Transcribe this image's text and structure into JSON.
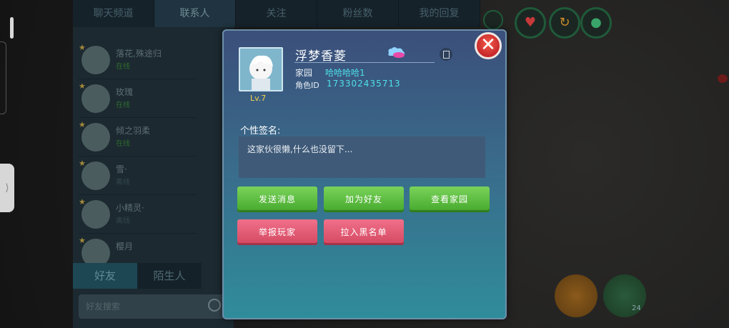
{
  "top_tabs": [
    "聊天频道",
    "联系人",
    "关注",
    "粉丝数",
    "我的回复"
  ],
  "friends": [
    {
      "name": "落花,殊途归",
      "status": "在线",
      "online": true
    },
    {
      "name": "玫瑰",
      "status": "在线",
      "online": true
    },
    {
      "name": "倾之羽柔",
      "status": "在线",
      "online": true
    },
    {
      "name": "雪·",
      "status": "离线",
      "online": false
    },
    {
      "name": "小精灵·",
      "status": "离线",
      "online": false
    },
    {
      "name": "樱月",
      "status": "",
      "online": false
    }
  ],
  "bottom_tabs": {
    "friends": "好友",
    "strangers": "陌生人"
  },
  "search": {
    "placeholder": "好友搜索"
  },
  "counter": "24",
  "dialog": {
    "player_name": "浮梦香菱",
    "level": "Lv.7",
    "home_label": "家园",
    "home_value": "哈哈哈哈1",
    "id_label": "角色ID",
    "id_value": "173302435713",
    "signature_label": "个性签名:",
    "signature_text": "这家伙很懒,什么也没留下...",
    "buttons": {
      "send_message": "发送消息",
      "add_friend": "加为好友",
      "view_home": "查看家园",
      "report": "举报玩家",
      "block": "拉入黑名单"
    }
  },
  "icons": {
    "close": "close-icon",
    "copy": "copy-icon",
    "heart": "heart-icon",
    "drop": "drop-icon",
    "megaphone": "megaphone-icon"
  },
  "colors": {
    "green_button": "#5cbd3e",
    "red_button": "#e05a72",
    "accent_cyan": "#4ee0e8",
    "close_red": "#dc3a34"
  }
}
